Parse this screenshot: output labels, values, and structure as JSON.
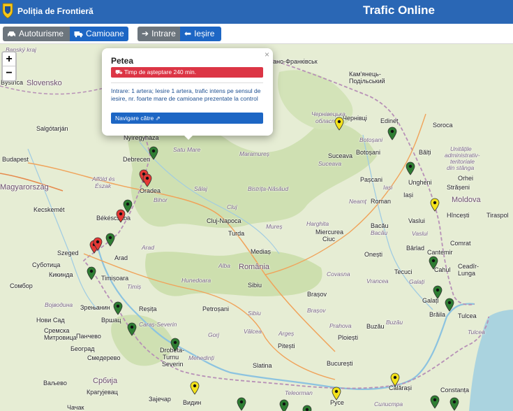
{
  "header": {
    "brand": "Poliția de Frontieră",
    "title": "Trafic Online"
  },
  "toolbar": {
    "cars_label": "Autoturisme",
    "trucks_label": "Camioane",
    "entry_label": "Intrare",
    "exit_label": "Ieșire"
  },
  "zoom": {
    "in": "+",
    "out": "−"
  },
  "popup": {
    "close": "×",
    "title": "Petea",
    "wait": "Timp de așteptare 240 min.",
    "description": "Intrare: 1 artera; Iesire 1 artera, trafic intens pe sensul de iesire, nr. foarte mare de camioane prezentate la control",
    "nav": "Navigare către"
  },
  "colors": {
    "header": "#2a67b5",
    "green": "#2e7d32",
    "red": "#e53935",
    "yellow": "#f3e21a"
  },
  "map_labels": {
    "countries": [
      "Slovensko",
      "Magyarország",
      "România",
      "Moldova",
      "Србија"
    ],
    "regions": [
      "Satu Mare",
      "Maramureș",
      "Chernivets'ka oblast",
      "Botoșani",
      "Suceava",
      "Iași",
      "Neamț",
      "Bistrița-Năsăud",
      "Sălaj",
      "Bihor",
      "Cluj",
      "Mureș",
      "Harghita",
      "Bacău",
      "Vaslui",
      "Galați",
      "Vrancea",
      "Covasna",
      "Brașov",
      "Alba",
      "Arad",
      "Timiș",
      "Hunedoara",
      "Sibiu",
      "Caraș-Severin",
      "Vâlcea",
      "Argeș",
      "Prahova",
      "Buzău",
      "Teleorman",
      "Mehedinți",
      "Alföld és Észak",
      "Vojvodina",
      "Olt",
      "Gorj",
      "Dâmbovița"
    ],
    "cities": [
      "Salgótarján",
      "Nyíregyháza",
      "Budapest",
      "Debrecen",
      "Oradea",
      "Kecskemét",
      "Békéscsaba",
      "Szeged",
      "Arad",
      "Timișoara",
      "Cluj-Napoca",
      "Turda",
      "Mediaș",
      "Sibiu",
      "Brașov",
      "Miercurea Ciuc",
      "Bacău",
      "Onești",
      "Roman",
      "Suceava",
      "Botoșani",
      "Pașcani",
      "Iași",
      "Ungheni",
      "Bălți",
      "Soroca",
      "Edineț",
      "Orhei",
      "Strășeni",
      "Hîncești",
      "Tiraspol",
      "Comrat",
      "Cantemir",
      "Cahul",
      "Ceadîr-Lunga",
      "Galați",
      "Brăila",
      "Tulcea",
      "Bârlad",
      "Tecuci",
      "Focșani",
      "Buzău",
      "Ploiești",
      "Pitești",
      "București",
      "Slatina",
      "Călărași",
      "Constanța",
      "Drobeta-Turnu Severin",
      "Reșița",
      "Petroșani",
      "Vršac",
      "Novi Sad",
      "Beograd",
      "Видин",
      "Русе",
      "Subotica",
      "Kikinda",
      "Zrenjanin",
      "Kam'yanets-Podilskyi",
      "Chernivtsi",
      "Ivano-Frankivsk"
    ]
  }
}
